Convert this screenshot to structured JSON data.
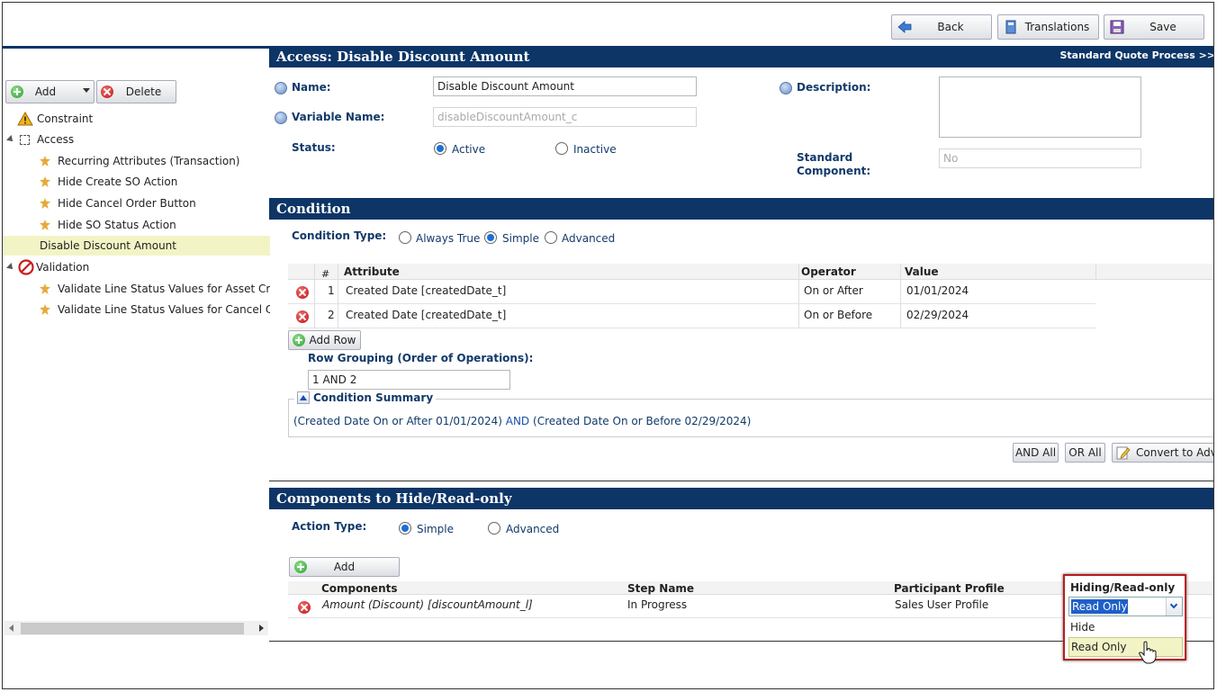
{
  "toolbar": {
    "back": "Back",
    "translations": "Translations",
    "save": "Save"
  },
  "left": {
    "add": "Add",
    "delete": "Delete",
    "tree": [
      {
        "label": "Constraint"
      },
      {
        "label": "Access"
      },
      {
        "label": "Recurring Attributes (Transaction)"
      },
      {
        "label": "Hide Create SO Action"
      },
      {
        "label": "Hide Cancel Order Button"
      },
      {
        "label": "Hide SO Status Action"
      },
      {
        "label": "Disable Discount Amount"
      },
      {
        "label": "Validation"
      },
      {
        "label": "Validate Line Status Values for Asset Creatic"
      },
      {
        "label": "Validate Line Status Values for Cancel Order"
      }
    ]
  },
  "header": {
    "title": "Access: Disable Discount Amount",
    "process_link": "Standard Quote Process >>"
  },
  "form": {
    "name_label": "Name:",
    "name_value": "Disable Discount Amount",
    "varname_label": "Variable Name:",
    "varname_value": "disableDiscountAmount_c",
    "status_label": "Status:",
    "status_active": "Active",
    "status_inactive": "Inactive",
    "description_label": "Description:",
    "standard_label_1": "Standard",
    "standard_label_2": "Component:",
    "standard_value": "No"
  },
  "condition": {
    "title": "Condition",
    "type_label": "Condition Type:",
    "opt_always": "Always True",
    "opt_simple": "Simple",
    "opt_advanced": "Advanced",
    "columns": [
      "#",
      "Attribute",
      "Operator",
      "Value"
    ],
    "rows": [
      {
        "n": "1",
        "attribute": "Created Date [createdDate_t]",
        "operator": "On or After",
        "value": "01/01/2024"
      },
      {
        "n": "2",
        "attribute": "Created Date [createdDate_t]",
        "operator": "On or Before",
        "value": "02/29/2024"
      }
    ],
    "add_row": "Add Row",
    "grouping_label": "Row Grouping (Order of Operations):",
    "grouping_value": "1 AND 2",
    "summary_label": "Condition Summary",
    "summary_part1": "(Created Date On or After 01/01/2024)",
    "summary_and": "AND",
    "summary_part2": "(Created Date On or Before 02/29/2024)",
    "and_all": "AND All",
    "or_all": "OR All",
    "convert": "Convert to Adva"
  },
  "components": {
    "title": "Components to Hide/Read-only",
    "action_label": "Action Type:",
    "opt_simple": "Simple",
    "opt_advanced": "Advanced",
    "add": "Add",
    "columns": [
      "Components",
      "Step Name",
      "Participant Profile",
      "Hiding/Read-only"
    ],
    "row": {
      "component": "Amount (Discount) [discountAmount_l]",
      "step": "In Progress",
      "profile": "Sales User Profile",
      "selected": "Read Only"
    },
    "options": [
      "Hide",
      "Read Only"
    ]
  }
}
